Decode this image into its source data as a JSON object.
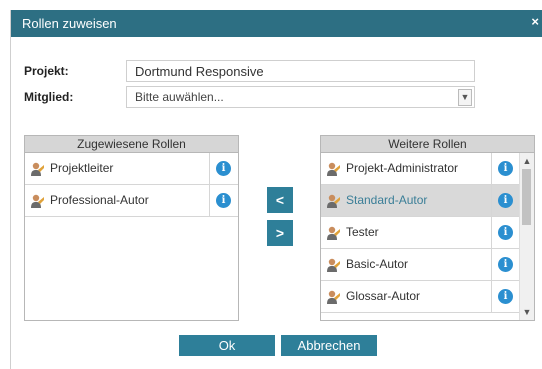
{
  "dialog": {
    "title": "Rollen zuweisen",
    "close_label": "×"
  },
  "form": {
    "projekt_label": "Projekt:",
    "projekt_value": "Dortmund Responsive",
    "mitglied_label": "Mitglied:",
    "mitglied_value": "Bitte auwählen..."
  },
  "assigned": {
    "header": "Zugewiesene Rollen",
    "items": [
      {
        "label": "Projektleiter"
      },
      {
        "label": "Professional-Autor"
      }
    ]
  },
  "available": {
    "header": "Weitere Rollen",
    "items": [
      {
        "label": "Projekt-Administrator"
      },
      {
        "label": "Standard-Autor",
        "selected": true
      },
      {
        "label": "Tester"
      },
      {
        "label": "Basic-Autor"
      },
      {
        "label": "Glossar-Autor"
      }
    ]
  },
  "move": {
    "left_label": "<",
    "right_label": ">"
  },
  "buttons": {
    "ok_label": "Ok",
    "cancel_label": "Abbrechen"
  },
  "icons": {
    "info": "i",
    "person": "person-icon",
    "scroll_up": "▲",
    "scroll_down": "▼",
    "dropdown": "▼"
  },
  "colors": {
    "titlebar": "#2d6f83",
    "button": "#2e7f99",
    "info": "#2b8fd0",
    "selected_text": "#3a7e97"
  }
}
